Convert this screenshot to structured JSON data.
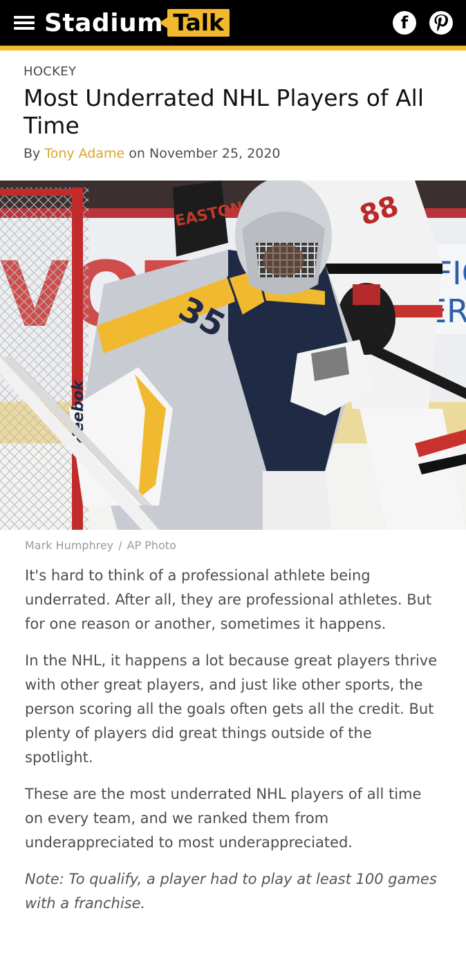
{
  "header": {
    "logo_primary": "Stadium",
    "logo_secondary": "Talk",
    "brand_color": "#f2b82e",
    "menu_icon": "hamburger-menu-icon",
    "social": [
      {
        "name": "facebook-icon",
        "glyph": "f"
      },
      {
        "name": "pinterest-icon",
        "glyph": "P"
      }
    ]
  },
  "article": {
    "category": "HOCKEY",
    "title": "Most Underrated NHL Players of All Time",
    "byline_prefix": "By",
    "author": "Tony Adame",
    "date_prefix": "on",
    "date": "November 25, 2020",
    "image": {
      "description": "Goaltender in yellow and navy number 35 jersey in front of net",
      "jersey_number": "35",
      "pad_brand": "Reebok",
      "glove_brand": "EASTON",
      "skater_number": "88",
      "boards_text_1": "Y FIGH",
      "boards_text_2": "CER"
    },
    "credit_photographer": "Mark Humphrey",
    "credit_separator": "/",
    "credit_agency": "AP Photo",
    "paragraphs": [
      "It's hard to think of a professional athlete being underrated. After all, they are professional athletes. But for one reason or another, sometimes it happens.",
      "In the NHL, it happens a lot because great players thrive with other great players, and just like other sports, the person scoring all the goals often gets all the credit. But plenty of players did great things outside of the spotlight.",
      "These are the most underrated NHL players of all time on every team, and we ranked them from underappreciated to most underappreciated."
    ],
    "note": "Note: To qualify, a player had to play at least 100 games with a franchise."
  }
}
